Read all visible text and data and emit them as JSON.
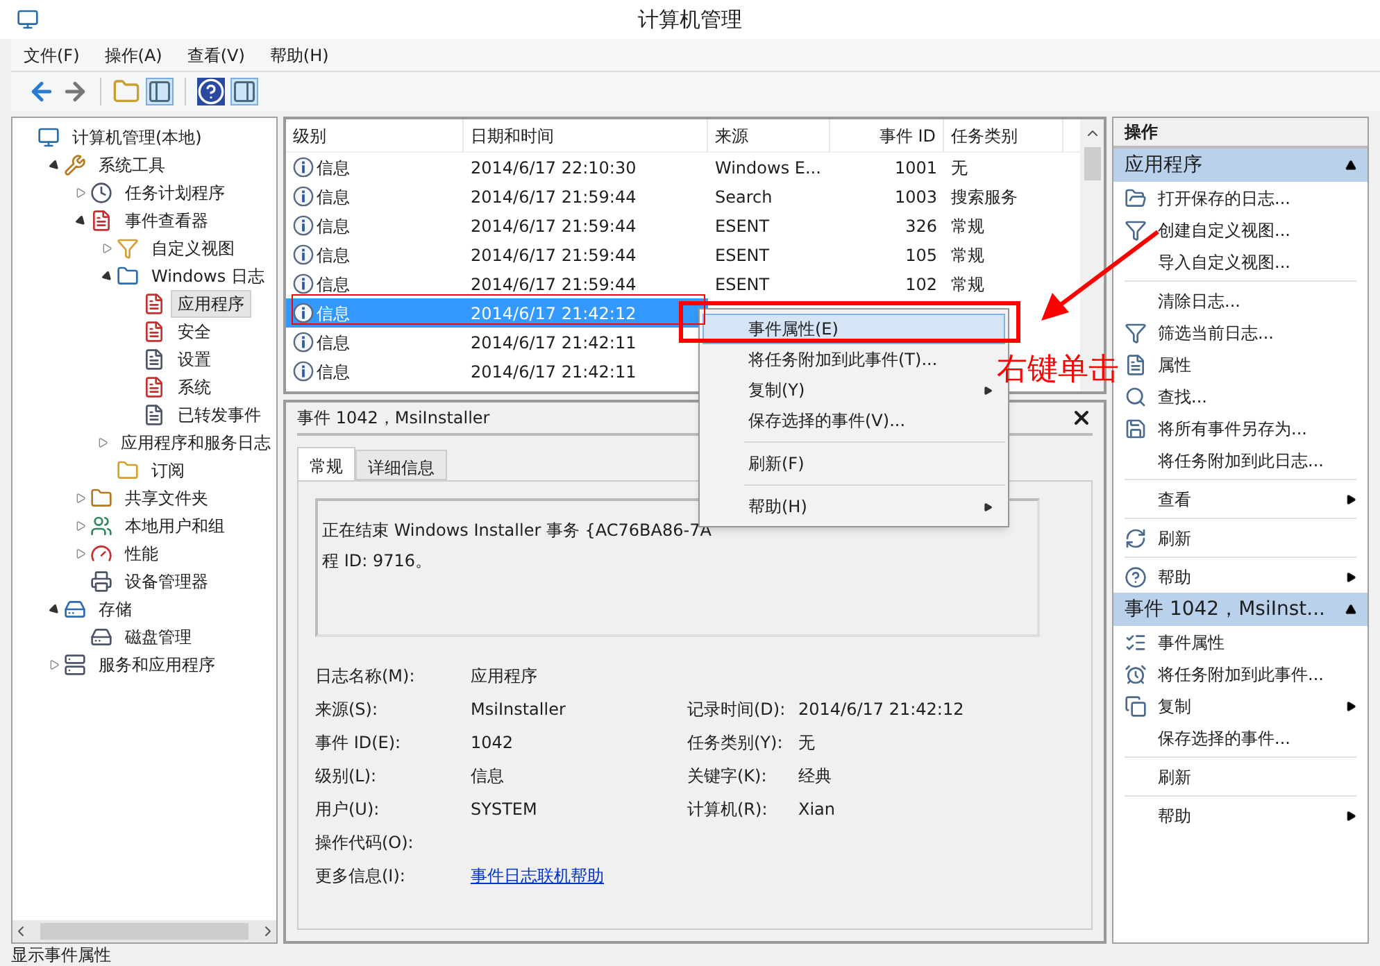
{
  "window": {
    "title": "计算机管理"
  },
  "menu": [
    "文件(F)",
    "操作(A)",
    "查看(V)",
    "帮助(H)"
  ],
  "tree": [
    {
      "label": "计算机管理(本地)",
      "selected": false,
      "children": [
        {
          "label": "系统工具",
          "selected": false,
          "expanded": true,
          "children": [
            {
              "label": "任务计划程序",
              "selected": false,
              "expanded": false
            },
            {
              "label": "事件查看器",
              "selected": false,
              "expanded": true,
              "children": [
                {
                  "label": "自定义视图",
                  "selected": false,
                  "expanded": false
                },
                {
                  "label": "Windows 日志",
                  "selected": false,
                  "expanded": true,
                  "children": [
                    {
                      "label": "应用程序",
                      "selected": true
                    },
                    {
                      "label": "安全",
                      "selected": false
                    },
                    {
                      "label": "设置",
                      "selected": false
                    },
                    {
                      "label": "系统",
                      "selected": false
                    },
                    {
                      "label": "已转发事件",
                      "selected": false
                    }
                  ]
                },
                {
                  "label": "应用程序和服务日志",
                  "selected": false,
                  "expanded": false
                },
                {
                  "label": "订阅",
                  "selected": false
                }
              ]
            },
            {
              "label": "共享文件夹",
              "selected": false,
              "expanded": false
            },
            {
              "label": "本地用户和组",
              "selected": false,
              "expanded": false
            },
            {
              "label": "性能",
              "selected": false,
              "expanded": false
            },
            {
              "label": "设备管理器",
              "selected": false
            }
          ]
        },
        {
          "label": "存储",
          "selected": false,
          "expanded": true,
          "children": [
            {
              "label": "磁盘管理",
              "selected": false
            }
          ]
        },
        {
          "label": "服务和应用程序",
          "selected": false,
          "expanded": false
        }
      ]
    }
  ],
  "table": {
    "columns": [
      "级别",
      "日期和时间",
      "来源",
      "事件 ID",
      "任务类别"
    ],
    "rows": [
      {
        "level": "信息",
        "date": "2014/6/17 22:10:30",
        "source": "Windows E...",
        "id": "1001",
        "category": "无",
        "selected": false
      },
      {
        "level": "信息",
        "date": "2014/6/17 21:59:44",
        "source": "Search",
        "id": "1003",
        "category": "搜索服务",
        "selected": false
      },
      {
        "level": "信息",
        "date": "2014/6/17 21:59:44",
        "source": "ESENT",
        "id": "326",
        "category": "常规",
        "selected": false
      },
      {
        "level": "信息",
        "date": "2014/6/17 21:59:44",
        "source": "ESENT",
        "id": "105",
        "category": "常规",
        "selected": false
      },
      {
        "level": "信息",
        "date": "2014/6/17 21:59:44",
        "source": "ESENT",
        "id": "102",
        "category": "常规",
        "selected": false
      },
      {
        "level": "信息",
        "date": "2014/6/17 21:42:12",
        "selected": true
      },
      {
        "level": "信息",
        "date": "2014/6/17 21:42:11",
        "selected": false
      },
      {
        "level": "信息",
        "date": "2014/6/17 21:42:11",
        "selected": false
      }
    ]
  },
  "context_menu": [
    {
      "kind": "item",
      "label": "事件属性(E)",
      "selected": true,
      "submenu": false
    },
    {
      "kind": "item",
      "label": "将任务附加到此事件(T)...",
      "selected": false,
      "submenu": false
    },
    {
      "kind": "item",
      "label": "复制(Y)",
      "selected": false,
      "submenu": true
    },
    {
      "kind": "item",
      "label": "保存选择的事件(V)...",
      "selected": false,
      "submenu": false
    },
    {
      "kind": "separator"
    },
    {
      "kind": "item",
      "label": "刷新(F)",
      "selected": false,
      "submenu": false
    },
    {
      "kind": "separator"
    },
    {
      "kind": "item",
      "label": "帮助(H)",
      "selected": false,
      "submenu": true
    }
  ],
  "detail": {
    "title": "事件 1042，MsiInstaller",
    "tabs": [
      {
        "label": "常规",
        "selected": true
      },
      {
        "label": "详细信息",
        "selected": false
      }
    ],
    "description": [
      "正在结束 Windows Installer 事务 {AC76BA86-7A",
      "程 ID: 9716。"
    ],
    "left_fields": [
      {
        "label": "日志名称(M):",
        "value": "应用程序"
      },
      {
        "label": "来源(S):",
        "value": "MsiInstaller"
      },
      {
        "label": "事件 ID(E):",
        "value": "1042"
      },
      {
        "label": "级别(L):",
        "value": "信息"
      },
      {
        "label": "用户(U):",
        "value": "SYSTEM"
      },
      {
        "label": "操作代码(O):"
      },
      {
        "label": "更多信息(I):",
        "link": "事件日志联机帮助"
      }
    ],
    "right_fields": [
      {
        "label": "记录时间(D):",
        "value": "2014/6/17 21:42:12"
      },
      {
        "label": "任务类别(Y):",
        "value": "无"
      },
      {
        "label": "关键字(K):",
        "value": "经典"
      },
      {
        "label": "计算机(R):",
        "value": "Xian"
      }
    ]
  },
  "actions": {
    "header": "操作",
    "sections": [
      {
        "title": "应用程序",
        "items": [
          {
            "kind": "item",
            "label": "打开保存的日志...",
            "submenu": false
          },
          {
            "kind": "item",
            "label": "创建自定义视图...",
            "submenu": false
          },
          {
            "kind": "item",
            "label": "导入自定义视图...",
            "submenu": false
          },
          {
            "kind": "separator"
          },
          {
            "kind": "item",
            "label": "清除日志...",
            "submenu": false
          },
          {
            "kind": "item",
            "label": "筛选当前日志...",
            "submenu": false
          },
          {
            "kind": "item",
            "label": "属性",
            "submenu": false
          },
          {
            "kind": "item",
            "label": "查找...",
            "submenu": false
          },
          {
            "kind": "item",
            "label": "将所有事件另存为...",
            "submenu": false
          },
          {
            "kind": "item",
            "label": "将任务附加到此日志...",
            "submenu": false
          },
          {
            "kind": "separator"
          },
          {
            "kind": "item",
            "label": "查看",
            "submenu": true
          },
          {
            "kind": "separator"
          },
          {
            "kind": "item",
            "label": "刷新",
            "submenu": false
          },
          {
            "kind": "separator"
          },
          {
            "kind": "item",
            "label": "帮助",
            "submenu": true
          }
        ]
      },
      {
        "title": "事件 1042，MsiInst...",
        "items": [
          {
            "kind": "item",
            "label": "事件属性",
            "submenu": false
          },
          {
            "kind": "item",
            "label": "将任务附加到此事件...",
            "submenu": false
          },
          {
            "kind": "item",
            "label": "复制",
            "submenu": true
          },
          {
            "kind": "item",
            "label": "保存选择的事件...",
            "submenu": false
          },
          {
            "kind": "separator"
          },
          {
            "kind": "item",
            "label": "刷新",
            "submenu": false
          },
          {
            "kind": "separator"
          },
          {
            "kind": "item",
            "label": "帮助",
            "submenu": true
          }
        ]
      }
    ]
  },
  "annotation": {
    "label": "右键单击"
  },
  "status_bar": "显示事件属性"
}
